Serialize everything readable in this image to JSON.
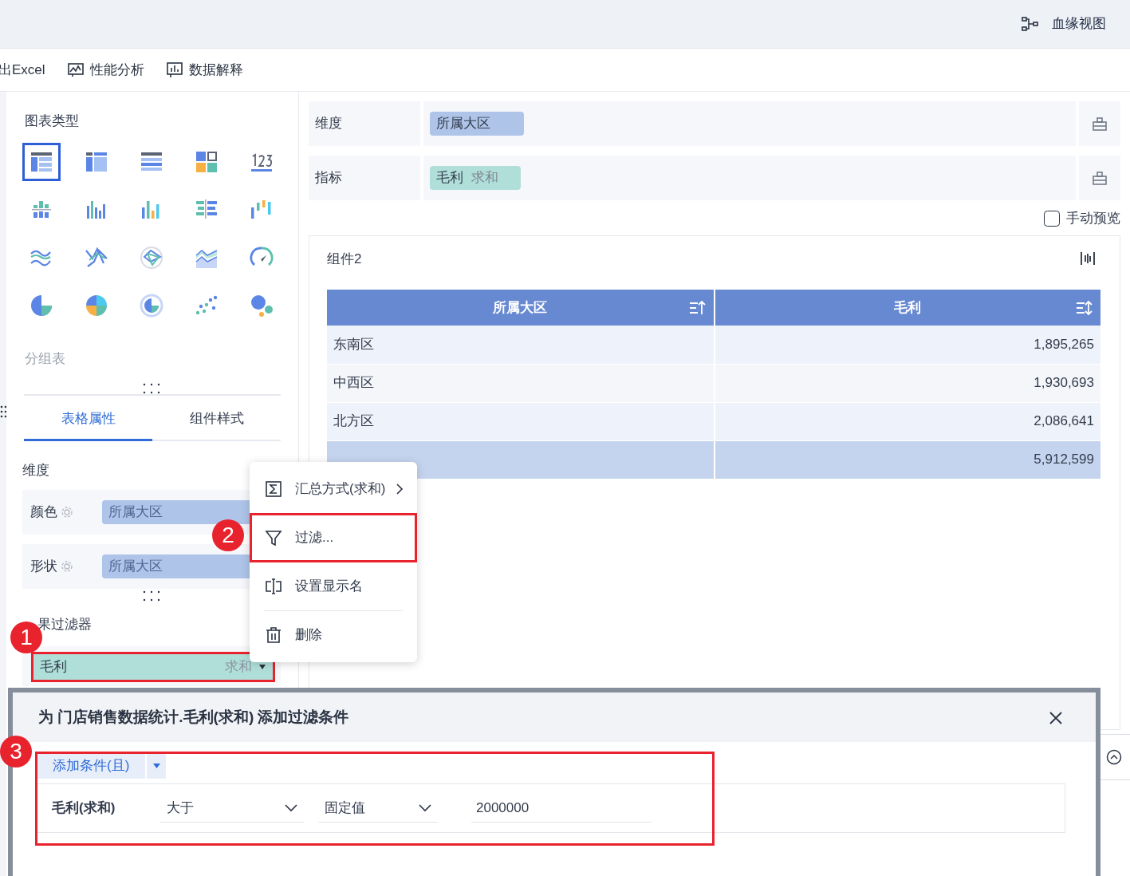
{
  "header": {
    "lineage_link": "血缘视图"
  },
  "toolbar": [
    {
      "label": "出Excel",
      "kind": "text"
    },
    {
      "label": "性能分析",
      "kind": "performance"
    },
    {
      "label": "数据解释",
      "kind": "explain"
    }
  ],
  "chart_panel": {
    "title": "图表类型",
    "chart_types": [
      {
        "selected": true
      },
      {
        "selected": false
      },
      {
        "selected": false
      },
      {
        "selected": false
      },
      {
        "selected": false
      },
      {
        "selected": false
      },
      {
        "selected": false
      },
      {
        "selected": false
      },
      {
        "selected": false
      },
      {
        "selected": false
      },
      {
        "selected": false
      },
      {
        "selected": false
      },
      {
        "selected": false
      },
      {
        "selected": false
      },
      {
        "selected": false
      },
      {
        "selected": false
      },
      {
        "selected": false
      },
      {
        "selected": false
      },
      {
        "selected": false
      },
      {
        "selected": false
      }
    ],
    "subtitle": "分组表"
  },
  "property_tabs": [
    {
      "label": "表格属性",
      "selected": true
    },
    {
      "label": "组件样式",
      "selected": false
    }
  ],
  "dimension_section": {
    "title": "维度",
    "rows": [
      {
        "label": "颜色",
        "field": "所属大区"
      },
      {
        "label": "形状",
        "field": "所属大区"
      }
    ]
  },
  "result_filter": {
    "title": "果过滤器",
    "field": "毛利",
    "aggregation": "求和",
    "highlighted": true
  },
  "bindings": [
    {
      "label": "维度",
      "chips": [
        {
          "kind": "dimension",
          "name": "所属大区"
        }
      ]
    },
    {
      "label": "指标",
      "chips": [
        {
          "kind": "measure",
          "name": "毛利",
          "aggregation": "求和"
        }
      ]
    }
  ],
  "manual_preview": {
    "label": "手动预览",
    "checked": false
  },
  "widget": {
    "title": "组件2",
    "table": {
      "columns": [
        "所属大区",
        "毛利"
      ],
      "rows": [
        {
          "kind": "data",
          "region": "东南区",
          "value": "1,895,265"
        },
        {
          "kind": "data",
          "region": "中西区",
          "value": "1,930,693"
        },
        {
          "kind": "data",
          "region": "北方区",
          "value": "2,086,641"
        },
        {
          "kind": "total",
          "value": "5,912,599"
        }
      ]
    }
  },
  "context_menu": [
    {
      "kind": "aggregate",
      "label": "汇总方式(求和)",
      "highlighted": false
    },
    {
      "kind": "filter",
      "label": "过滤...",
      "highlighted": true
    },
    {
      "kind": "rename",
      "label": "设置显示名",
      "highlighted": false
    },
    {
      "kind": "delete",
      "label": "删除",
      "highlighted": false
    }
  ],
  "dialog": {
    "title": "为 门店销售数据统计.毛利(求和) 添加过滤条件",
    "add_button": "添加条件(且)",
    "highlighted": true,
    "condition": {
      "field": "毛利(求和)",
      "operator": "大于",
      "value_type": "固定值",
      "value": "2000000"
    }
  },
  "callouts": [
    {
      "number": "1"
    },
    {
      "number": "2"
    },
    {
      "number": "3"
    }
  ]
}
